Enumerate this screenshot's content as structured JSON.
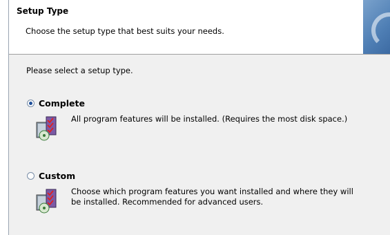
{
  "header": {
    "title": "Setup Type",
    "subtitle": "Choose the setup type that best suits your needs."
  },
  "prompt": "Please select a setup type.",
  "options": [
    {
      "label": "Complete",
      "selected": true,
      "description": "All program features will be installed. (Requires the most disk space.)",
      "icon": "package-icon"
    },
    {
      "label": "Custom",
      "selected": false,
      "description": "Choose which program features you want installed and where they will be installed. Recommended for advanced users.",
      "icon": "package-icon"
    }
  ],
  "colors": {
    "header_bg": "#ffffff",
    "panel_bg": "#f0f0f0",
    "radio_dot": "#1f4f9a"
  }
}
